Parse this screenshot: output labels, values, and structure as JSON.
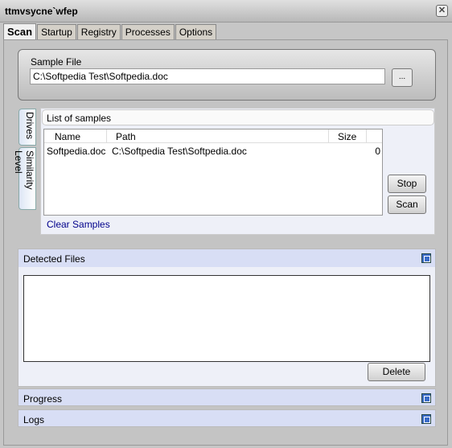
{
  "window": {
    "title": "ttmvsycne`wfep",
    "close": "✕"
  },
  "tabs": [
    "Scan",
    "Startup",
    "Registry",
    "Processes",
    "Options"
  ],
  "sample_file": {
    "label": "Sample File",
    "value": "C:\\Softpedia Test\\Softpedia.doc",
    "browse": "..."
  },
  "side_tabs": [
    "Drives",
    "Similarity Level"
  ],
  "samples": {
    "title": "List of samples",
    "columns": [
      "Name",
      "Path",
      "Size"
    ],
    "rows": [
      {
        "name": "Softpedia.doc",
        "path": "C:\\Softpedia Test\\Softpedia.doc",
        "size": "0"
      }
    ],
    "clear": "Clear Samples",
    "stop": "Stop",
    "scan": "Scan"
  },
  "detected": {
    "title": "Detected Files",
    "delete": "Delete"
  },
  "progress": {
    "title": "Progress"
  },
  "logs": {
    "title": "Logs"
  }
}
